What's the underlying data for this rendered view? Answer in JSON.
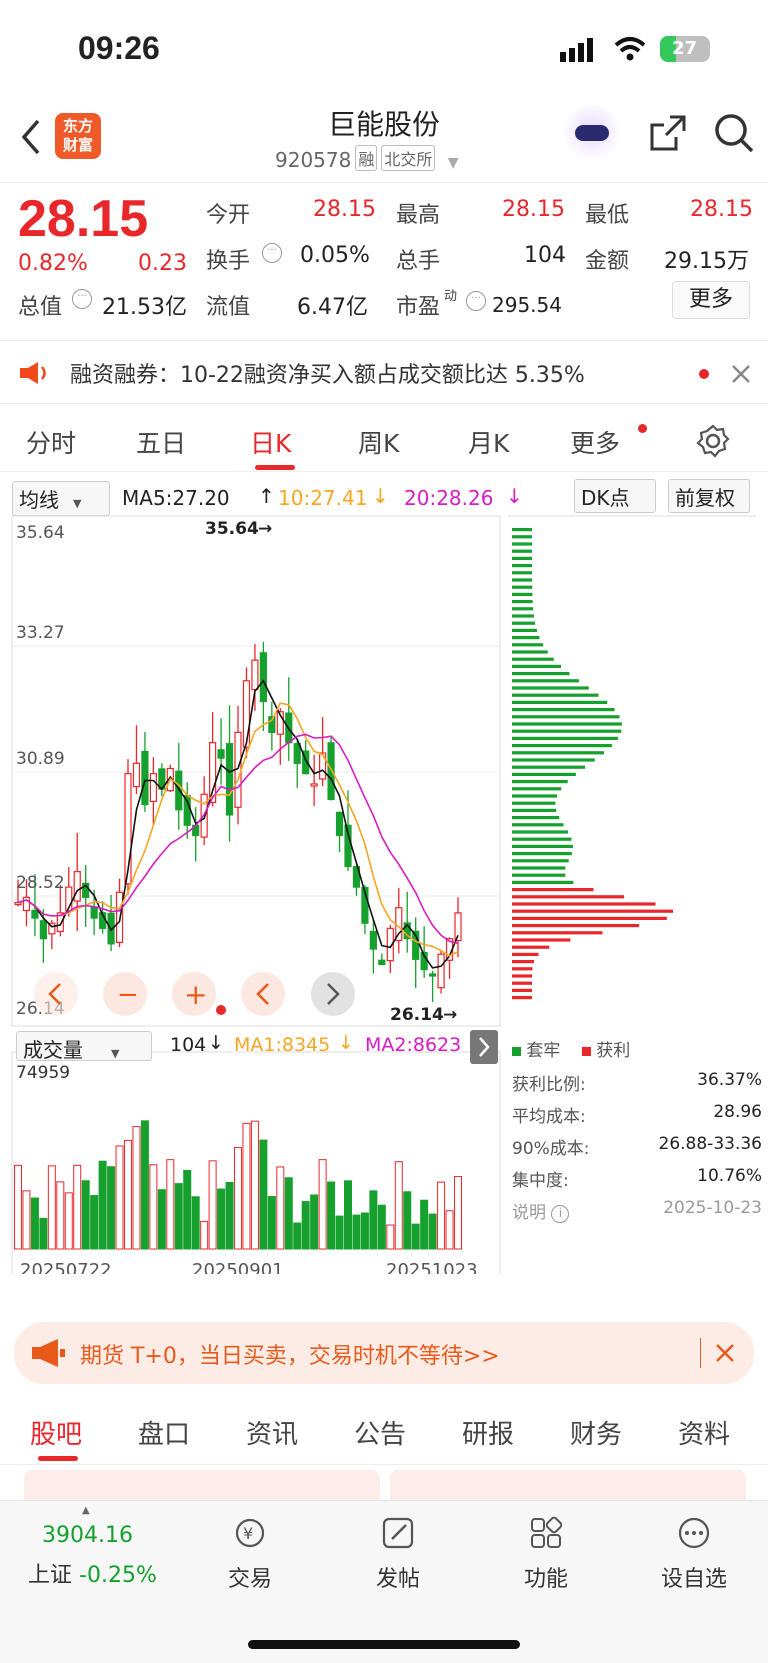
{
  "status_bar": {
    "time": "09:26",
    "battery": "27"
  },
  "header": {
    "logo_text": "东方\n财富",
    "stock_name": "巨能股份",
    "stock_code": "920578",
    "tag_margin": "融",
    "tag_exchange": "北交所"
  },
  "quote": {
    "price": "28.15",
    "change_pct": "0.82%",
    "change": "0.23",
    "fields": [
      {
        "label": "今开",
        "value": "28.15",
        "color": "red"
      },
      {
        "label": "最高",
        "value": "28.15",
        "color": "red"
      },
      {
        "label": "最低",
        "value": "28.15",
        "color": "red"
      },
      {
        "label": "换手",
        "value": "0.05%",
        "color": "dark"
      },
      {
        "label": "总手",
        "value": "104",
        "color": "dark"
      },
      {
        "label": "金额",
        "value": "29.15万",
        "color": "dark"
      },
      {
        "label": "总值",
        "value": "21.53亿",
        "color": "dark"
      },
      {
        "label": "流值",
        "value": "6.47亿",
        "color": "dark"
      },
      {
        "label": "市盈",
        "value": "295.54",
        "color": "dark"
      }
    ],
    "pe_sup": "动",
    "more_label": "更多"
  },
  "notice": {
    "text": "融资融券：10-22融资净买入额占成交额比达 5.35%"
  },
  "period_tabs": [
    "分时",
    "五日",
    "日K",
    "周K",
    "月K",
    "更多"
  ],
  "active_tab": 2,
  "ma_bar": {
    "type_select": "均线",
    "ma5": "MA5:27.20",
    "ma10": "10:27.41",
    "ma20": "20:28.26",
    "dk_label": "DK点",
    "adjust_label": "前复权"
  },
  "chart_data": {
    "type": "candlestick",
    "price_axis_labels": [
      "35.64",
      "33.27",
      "30.89",
      "28.52",
      "26.14"
    ],
    "ylim": [
      26.14,
      35.64
    ],
    "high_marker": "35.64",
    "low_marker": "26.14",
    "date_labels": [
      "20250722",
      "20250901",
      "20251023"
    ],
    "volume_top": "74959",
    "volume_select": "成交量",
    "volume_latest": "104",
    "vol_ma1": "MA1:8345",
    "vol_ma2": "MA2:8623",
    "legend_loss": "套牢",
    "legend_profit": "获利",
    "colors": {
      "up": "#e8272b",
      "down": "#16a02e",
      "ma5": "#111111",
      "ma10": "#f5a623",
      "ma20": "#d61dc1"
    }
  },
  "chip_info": [
    {
      "label": "获利比例:",
      "value": "36.37%"
    },
    {
      "label": "平均成本:",
      "value": "28.96"
    },
    {
      "label": "90%成本:",
      "value": "26.88-33.36"
    },
    {
      "label": "集中度:",
      "value": "10.76%"
    }
  ],
  "chip_note": {
    "label": "说明",
    "date": "2025-10-23"
  },
  "promo": {
    "text": "期货 T+0，当日买卖，交易时机不等待>>"
  },
  "sub_tabs": [
    "股吧",
    "盘口",
    "资讯",
    "公告",
    "研报",
    "财务",
    "资料"
  ],
  "bottom_nav": {
    "index_value": "3904.16",
    "index_name": "上证",
    "index_change": "-0.25%",
    "items": [
      "交易",
      "发帖",
      "功能",
      "设自选"
    ]
  }
}
